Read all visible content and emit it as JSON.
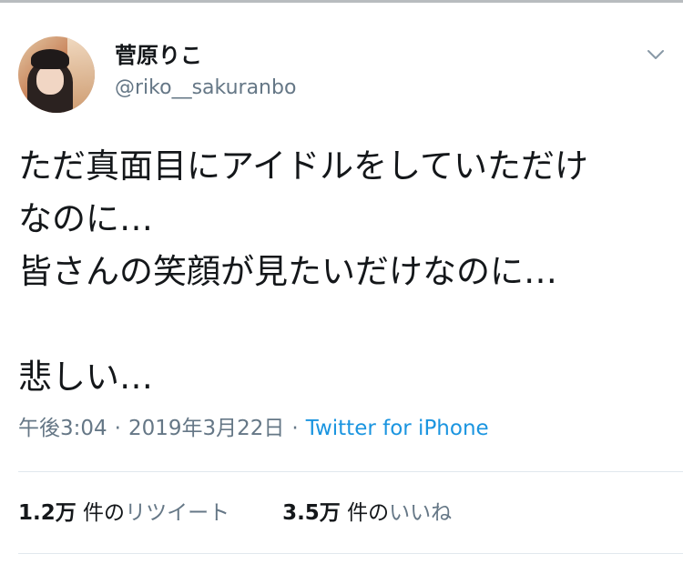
{
  "user": {
    "display_name": "菅原りこ",
    "handle": "@riko__sakuranbo"
  },
  "tweet": {
    "text": "ただ真面目にアイドルをしていただけ\nなのに…\n皆さんの笑顔が見たいだけなのに…\n\n悲しい…",
    "time": "午後3:04",
    "date": "2019年3月22日",
    "separator": "·",
    "source": "Twitter for iPhone"
  },
  "stats": {
    "retweets": {
      "count": "1.2万",
      "unit": " 件の",
      "label": "リツイート"
    },
    "likes": {
      "count": "3.5万",
      "unit": " 件の",
      "label": "いいね"
    }
  },
  "icons": {
    "menu": "chevron-down-icon",
    "avatar": "profile-avatar"
  },
  "colors": {
    "text": "#14171a",
    "secondary": "#657786",
    "link": "#1b95e0",
    "divider": "#e1e8ed"
  }
}
